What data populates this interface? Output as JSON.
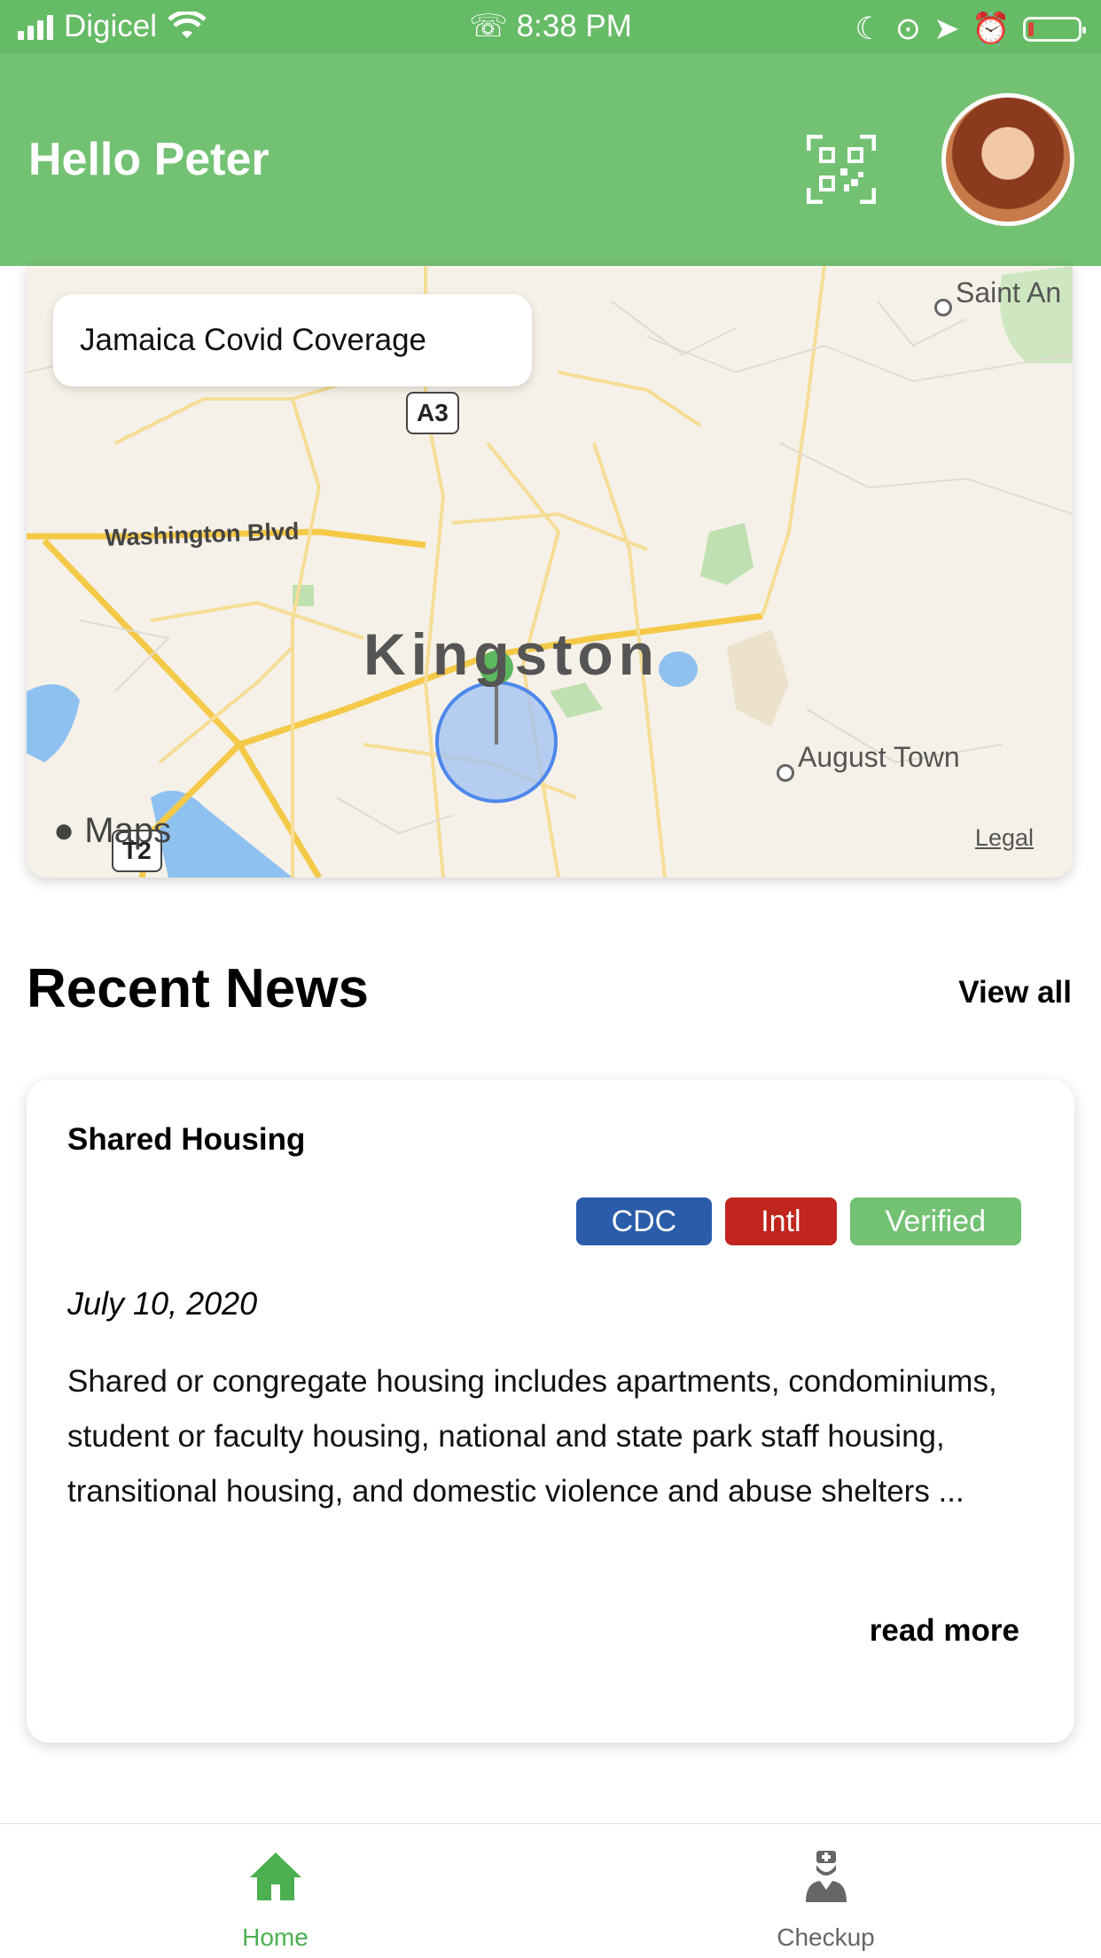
{
  "status_bar": {
    "carrier": "Digicel",
    "time": "8:38 PM"
  },
  "header": {
    "greeting": "Hello Peter",
    "qr_icon": "qr-code-icon",
    "avatar": "user-avatar"
  },
  "map": {
    "chip_label": "Jamaica Covid Coverage",
    "city": "Kingston",
    "places": [
      "Saint An",
      "August Town"
    ],
    "roads": [
      "Washington Blvd"
    ],
    "shields": [
      "A3",
      "T2"
    ],
    "attribution": "Maps",
    "legal": "Legal"
  },
  "news": {
    "section_title": "Recent News",
    "view_all": "View all",
    "card": {
      "title": "Shared Housing",
      "tags": [
        {
          "label": "CDC",
          "color": "#2a5caa"
        },
        {
          "label": "Intl",
          "color": "#c0261d"
        },
        {
          "label": "Verified",
          "color": "#73c173"
        }
      ],
      "date": "July 10, 2020",
      "body": "Shared or congregate housing includes apartments, condominiums, student or faculty housing, national and state park staff housing, transitional housing, and domestic violence and abuse shelters ...",
      "read_more": "read more"
    }
  },
  "tabbar": {
    "home": {
      "label": "Home",
      "icon": "home-icon",
      "color": "#4caf50"
    },
    "checkup": {
      "label": "Checkup",
      "icon": "doctor-icon",
      "color": "#666666"
    }
  }
}
